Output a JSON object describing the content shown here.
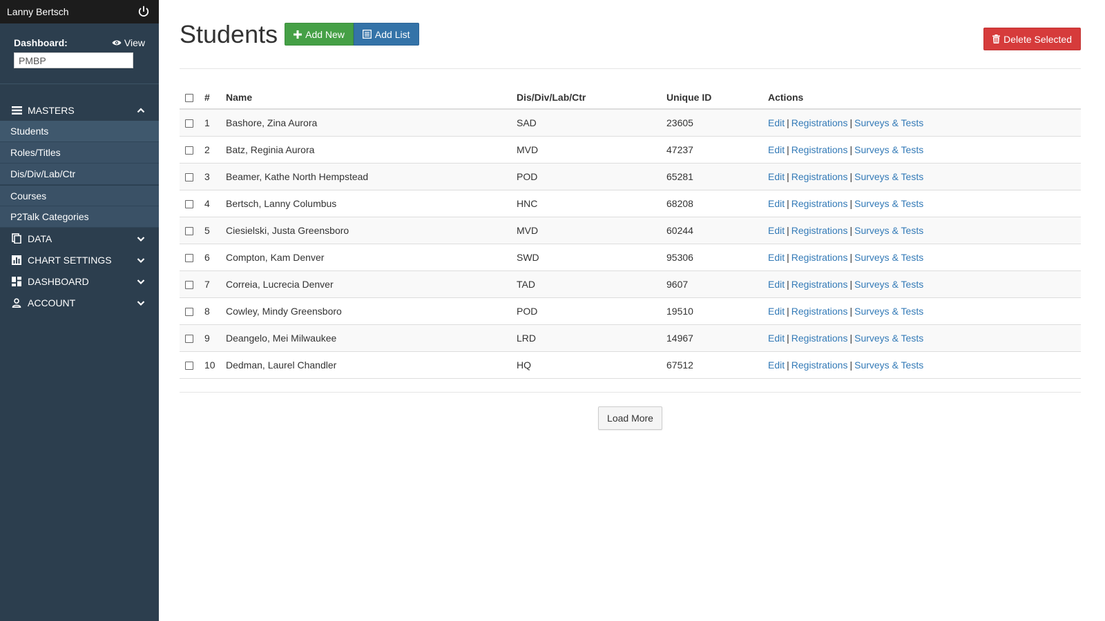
{
  "sidebar": {
    "user_name": "Lanny Bertsch",
    "dashboard_label": "Dashboard:",
    "view_label": "View",
    "dashboard_value": "PMBP",
    "masters_label": "MASTERS",
    "masters_items": [
      "Students",
      "Roles/Titles",
      "Dis/Div/Lab/Ctr",
      "Courses",
      "P2Talk Categories"
    ],
    "data_label": "DATA",
    "chart_settings_label": "CHART SETTINGS",
    "dashboard_menu_label": "DASHBOARD",
    "account_label": "ACCOUNT"
  },
  "header": {
    "title": "Students",
    "add_new_label": "Add New",
    "add_list_label": "Add List",
    "delete_selected_label": "Delete Selected"
  },
  "table": {
    "headers": {
      "num": "#",
      "name": "Name",
      "div": "Dis/Div/Lab/Ctr",
      "uid": "Unique ID",
      "actions": "Actions"
    },
    "rows": [
      {
        "num": "1",
        "name": "Bashore, Zina Aurora",
        "div": "SAD",
        "uid": "23605"
      },
      {
        "num": "2",
        "name": "Batz, Reginia Aurora",
        "div": "MVD",
        "uid": "47237"
      },
      {
        "num": "3",
        "name": "Beamer, Kathe North Hempstead",
        "div": "POD",
        "uid": "65281"
      },
      {
        "num": "4",
        "name": "Bertsch, Lanny Columbus",
        "div": "HNC",
        "uid": "68208"
      },
      {
        "num": "5",
        "name": "Ciesielski, Justa Greensboro",
        "div": "MVD",
        "uid": "60244"
      },
      {
        "num": "6",
        "name": "Compton, Kam Denver",
        "div": "SWD",
        "uid": "95306"
      },
      {
        "num": "7",
        "name": "Correia, Lucrecia Denver",
        "div": "TAD",
        "uid": "9607"
      },
      {
        "num": "8",
        "name": "Cowley, Mindy Greensboro",
        "div": "POD",
        "uid": "19510"
      },
      {
        "num": "9",
        "name": "Deangelo, Mei Milwaukee",
        "div": "LRD",
        "uid": "14967"
      },
      {
        "num": "10",
        "name": "Dedman, Laurel Chandler",
        "div": "HQ",
        "uid": "67512"
      }
    ],
    "action_edit": "Edit",
    "action_registrations": "Registrations",
    "action_surveys": "Surveys & Tests",
    "action_separator": "|"
  },
  "load_more_label": "Load More",
  "colors": {
    "sidebar_bg": "#2c3e4e",
    "topbar_bg": "#1c1c1c",
    "add_new": "#45a046",
    "add_list": "#3473a8",
    "delete": "#d63b3b",
    "link": "#337ab7"
  }
}
